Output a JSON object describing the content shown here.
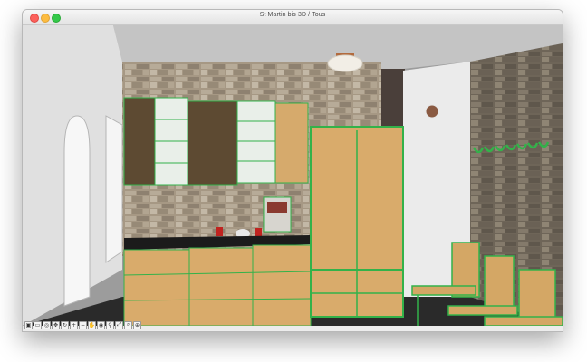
{
  "window": {
    "title": "St Martin bis 3D / Tous",
    "traffic_lights": [
      "close",
      "minimize",
      "zoom"
    ]
  },
  "scene": {
    "type": "3D furniture view",
    "objects": [
      "ceiling-lamp",
      "stone-back-wall",
      "stone-right-wall",
      "upper-wall-cabinets",
      "open-glass-cabinets",
      "coffee-machine",
      "kettle",
      "red-mugs",
      "kitchen-counter",
      "lower-drawer-cabinets",
      "tall-wardrobe",
      "white-column",
      "wall-clock",
      "coat-hook-rack",
      "wooden-chairs",
      "arched-window",
      "rectangular-window"
    ]
  },
  "toolbar": {
    "icons": [
      "view-icon",
      "plan-icon",
      "camera-icon",
      "move-icon",
      "rotate-icon",
      "zoom-in-icon",
      "zoom-out-icon",
      "pan-icon",
      "orbit-icon",
      "walk-icon",
      "fit-icon",
      "search-icon",
      "zoom-window-icon"
    ],
    "glyphs": [
      "▣",
      "▭",
      "◎",
      "✥",
      "↻",
      "+",
      "−",
      "✋",
      "◉",
      "🚶",
      "⤢",
      "⌕",
      "⊕"
    ]
  },
  "colors": {
    "cabinet_wood": "#d8aa6a",
    "cabinet_dark": "#5a4630",
    "edge_highlight": "#33b24a",
    "stone": "#a39683",
    "ceiling": "#c5c5c5",
    "left_wall": "#e2e2e2",
    "counter_top": "#1a1a1a"
  }
}
